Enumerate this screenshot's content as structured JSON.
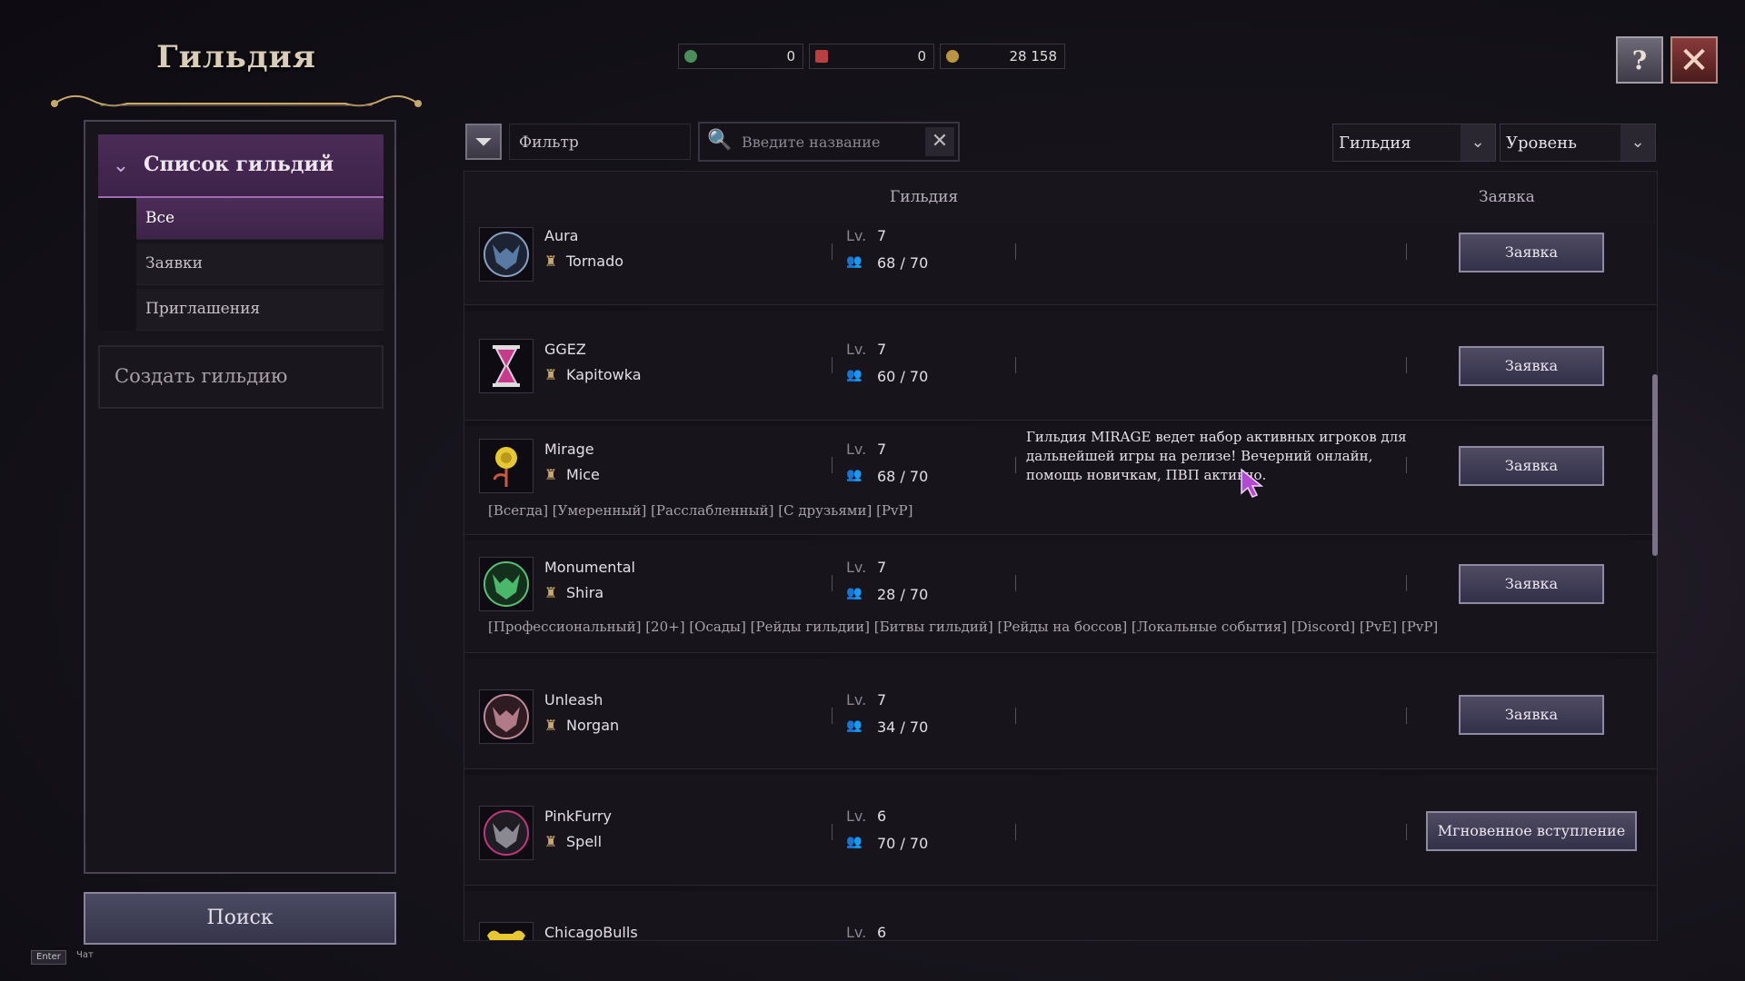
{
  "header": {
    "title": "Гильдия"
  },
  "currency": [
    {
      "icon": "green-orb-icon",
      "value": "0",
      "color": "#5fae6a"
    },
    {
      "icon": "red-gem-icon",
      "value": "0",
      "color": "#c14a4a"
    },
    {
      "icon": "gold-coin-icon",
      "value": "28 158",
      "color": "#c9a44a"
    }
  ],
  "sidebar": {
    "category": "Список гильдий",
    "items": [
      {
        "label": "Все",
        "active": true
      },
      {
        "label": "Заявки",
        "active": false
      },
      {
        "label": "Приглашения",
        "active": false
      }
    ],
    "create_label": "Создать гильдию",
    "search_label": "Поиск"
  },
  "footer": {
    "enter_key": "Enter",
    "chat_label": "Чат"
  },
  "filter": {
    "label": "Фильтр",
    "search_placeholder": "Введите название",
    "dropdown1": "Гильдия",
    "dropdown2": "Уровень"
  },
  "table": {
    "col_guild": "Гильдия",
    "col_apply": "Заявка",
    "lv_label": "Lv.",
    "rows": [
      {
        "name": "Aura",
        "leader": "Tornado",
        "level": "7",
        "members": "68 / 70",
        "description": "",
        "tags": "",
        "button": "Заявка",
        "emblem": "wolf-blue"
      },
      {
        "name": "GGEZ",
        "leader": "Kapitowka",
        "level": "7",
        "members": "60 / 70",
        "description": "",
        "tags": "",
        "button": "Заявка",
        "emblem": "hourglass"
      },
      {
        "name": "Mirage",
        "leader": "Mice",
        "level": "7",
        "members": "68 / 70",
        "description": "Гильдия MIRAGE ведет набор активных игроков для дальнейшей игры на релизе! Вечерний онлайн, помощь новичкам, ПВП активно.",
        "tags": "[Всегда] [Умеренный] [Расслабленный] [С друзьями] [PvP]",
        "button": "Заявка",
        "emblem": "rose"
      },
      {
        "name": "Monumental",
        "leader": "Shira",
        "level": "7",
        "members": "28 / 70",
        "description": "",
        "tags": "[Профессиональный] [20+] [Осады] [Рейды гильдии] [Битвы гильдий] [Рейды на боссов] [Локальные события] [Discord] [PvE] [PvP]",
        "button": "Заявка",
        "emblem": "wolf-green"
      },
      {
        "name": "Unleash",
        "leader": "Norgan",
        "level": "7",
        "members": "34 / 70",
        "description": "",
        "tags": "",
        "button": "Заявка",
        "emblem": "wolf-pink"
      },
      {
        "name": "PinkFurry",
        "leader": "Spell",
        "level": "6",
        "members": "70 / 70",
        "description": "",
        "tags": "",
        "button": "Мгновенное вступление",
        "emblem": "wolf-gray"
      },
      {
        "name": "ChicagoBulls",
        "leader": "",
        "level": "6",
        "members": "",
        "description": "",
        "tags": "",
        "button": "",
        "emblem": "bull-gold"
      }
    ]
  }
}
